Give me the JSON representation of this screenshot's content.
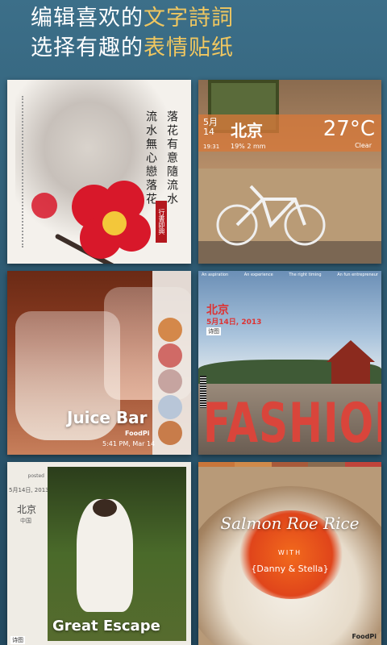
{
  "header": {
    "line1_prefix": "编辑喜欢的",
    "line1_accent": "文字詩詞",
    "line2_prefix": "选择有趣的",
    "line2_accent": "表情贴纸"
  },
  "card_flower": {
    "poem_columns": [
      "落花有意隨流水",
      "流水無心戀落花"
    ],
    "seal": "行書即興"
  },
  "card_bicycle": {
    "date": "5月\n14",
    "time": "19:31",
    "city": "北京",
    "meta": "19%  2 mm",
    "temp": "27°C",
    "condition": "Clear"
  },
  "card_juice": {
    "title": "Juice Bar",
    "brand": "FoodPi",
    "stamp": "5:41 PM, Mar 14",
    "palette": [
      "#d4884a",
      "#d06a66",
      "#c6a4a0",
      "#b8c6d8",
      "#c87c4a"
    ]
  },
  "card_fashion": {
    "top_labels": [
      "An aspiration",
      "An experience",
      "The right timing",
      "An fun entrepreneur"
    ],
    "city": "北京",
    "date": "5月14日, 2013",
    "tag": "诗图",
    "headline": "FASHION"
  },
  "card_cat": {
    "posted": "posted",
    "date": "5月14日, 2013",
    "city": "北京",
    "country": "中国",
    "title": "Great Escape",
    "tag": "诗图"
  },
  "card_rice": {
    "title": "Salmon Roe Rice",
    "with": "WITH",
    "names": "{Danny & Stella}",
    "brand": "FoodPi",
    "strip_colors": [
      "#c9763a",
      "#d08a4a",
      "#a85a3a",
      "#8a6b4f",
      "#c0443a"
    ]
  }
}
